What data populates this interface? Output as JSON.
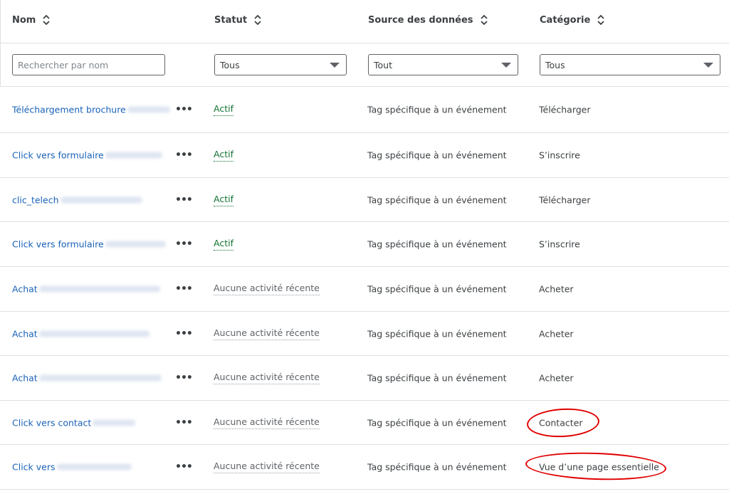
{
  "header": {
    "col_name": "Nom",
    "col_status": "Statut",
    "col_source": "Source des données",
    "col_category": "Catégorie"
  },
  "filters": {
    "search_placeholder": "Rechercher par nom",
    "status_value": "Tous",
    "source_value": "Tout",
    "category_value": "Tous"
  },
  "rows": [
    {
      "name": "Téléchargement brochure",
      "more": "•••",
      "status": "Actif",
      "source": "Tag spécifique à un événement",
      "category": "Télécharger"
    },
    {
      "name": "Click vers formulaire",
      "more": "•••",
      "status": "Actif",
      "source": "Tag spécifique à un événement",
      "category": "S’inscrire"
    },
    {
      "name": "clic_telech",
      "more": "•••",
      "status": "Actif",
      "source": "Tag spécifique à un événement",
      "category": "Télécharger"
    },
    {
      "name": "Click vers formulaire",
      "more": "•••",
      "status": "Actif",
      "source": "Tag spécifique à un événement",
      "category": "S’inscrire"
    },
    {
      "name": "Achat",
      "more": "•••",
      "status": "Aucune activité récente",
      "source": "Tag spécifique à un événement",
      "category": "Acheter"
    },
    {
      "name": "Achat",
      "more": "•••",
      "status": "Aucune activité récente",
      "source": "Tag spécifique à un événement",
      "category": "Acheter"
    },
    {
      "name": "Achat",
      "more": "•••",
      "status": "Aucune activité récente",
      "source": "Tag spécifique à un événement",
      "category": "Acheter"
    },
    {
      "name": "Click vers contact",
      "more": "•••",
      "status": "Aucune activité récente",
      "source": "Tag spécifique à un événement",
      "category": "Contacter"
    },
    {
      "name": "Click vers",
      "more": "•••",
      "status": "Aucune activité récente",
      "source": "Tag spécifique à un événement",
      "category": "Vue d’une page essentielle"
    }
  ],
  "colors": {
    "link": "#1a62b8",
    "active": "#137333",
    "annotation": "#e00000"
  }
}
